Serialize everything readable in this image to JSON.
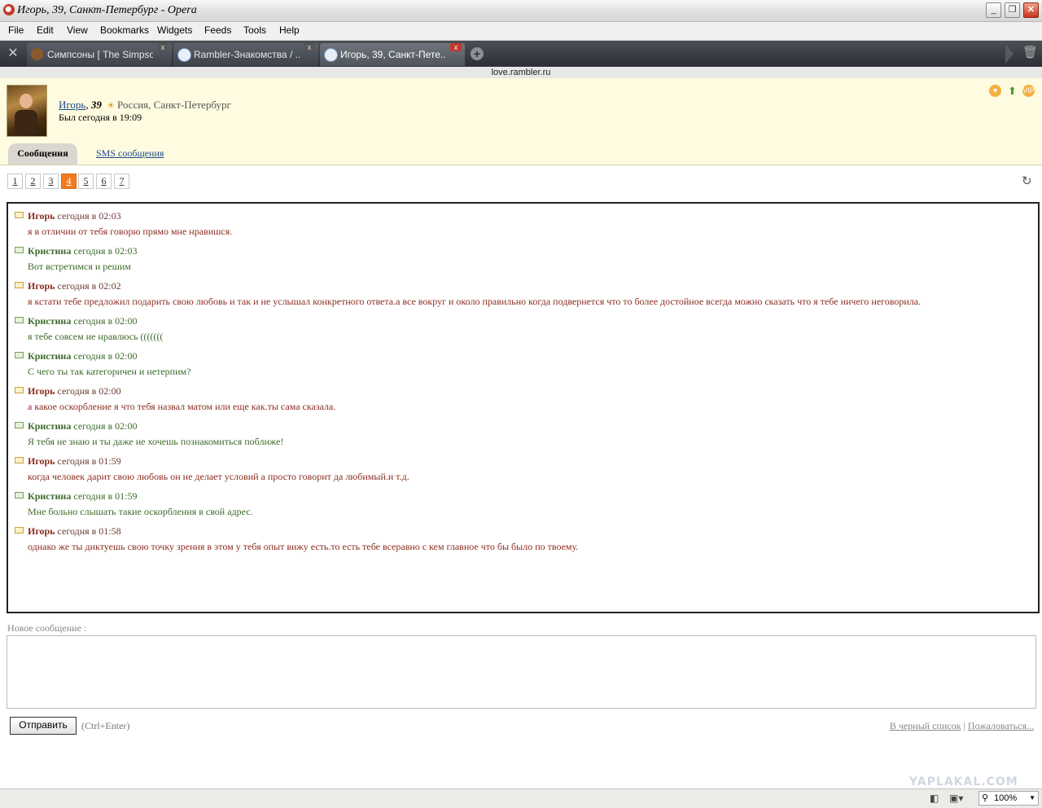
{
  "window": {
    "title": "Игорь, 39, Санкт-Петербург - Opera"
  },
  "menu": [
    "File",
    "Edit",
    "View",
    "Bookmarks",
    "Widgets",
    "Feeds",
    "Tools",
    "Help"
  ],
  "tabs": [
    {
      "label": "Симпсоны [ The Simpso...",
      "favicon": "simpsons-icon",
      "active": false
    },
    {
      "label": "Rambler-Знакомства / ...",
      "favicon": "rambler-icon",
      "active": false
    },
    {
      "label": "Игорь, 39, Санкт-Пете...",
      "favicon": "rambler-icon",
      "active": true
    }
  ],
  "address": "love.rambler.ru",
  "profile": {
    "name": "Игорь",
    "age": "39",
    "location": "Россия, Санкт-Петербург",
    "last_seen": "Был сегодня в 19:09"
  },
  "section_tabs": {
    "messages": "Сообщения",
    "sms": "SMS сообщения"
  },
  "pager": {
    "pages": [
      "1",
      "2",
      "3",
      "4",
      "5",
      "6",
      "7"
    ],
    "current": "4"
  },
  "messages": [
    {
      "author": "Игорь",
      "time": "сегодня в 02:03",
      "text": "я в отличии от тебя говорю прямо мне нравишся."
    },
    {
      "author": "Кристина",
      "time": "сегодня в 02:03",
      "text": "Вот встретимся и решим"
    },
    {
      "author": "Игорь",
      "time": "сегодня в 02:02",
      "text": "я кстати тебе предложил подарить свою любовь и так и не услышал конкретного ответа.а все вокруг и около правильно когда подвернется что то более достойное всегда можно сказать что я тебе ничего неговорила."
    },
    {
      "author": "Кристина",
      "time": "сегодня в 02:00",
      "text": "я тебе совсем не нравлюсь ((((((("
    },
    {
      "author": "Кристина",
      "time": "сегодня в 02:00",
      "text": "С чего ты так категоричен и нетерпим?"
    },
    {
      "author": "Игорь",
      "time": "сегодня в 02:00",
      "text": "а какое оскорбление я что тебя назвал матом или еще как.ты сама сказала."
    },
    {
      "author": "Кристина",
      "time": "сегодня в 02:00",
      "text": "Я тебя не знаю и ты даже не хочешь познакомиться поближе!"
    },
    {
      "author": "Игорь",
      "time": "сегодня в 01:59",
      "text": "когда человек дарит свою любовь он не делает условий а просто говорит да любимый.и т.д."
    },
    {
      "author": "Кристина",
      "time": "сегодня в 01:59",
      "text": "Мне больно слышать такие оскорбления в свой адрес."
    },
    {
      "author": "Игорь",
      "time": "сегодня в 01:58",
      "text": "однако же ты диктуешь свою точку зрения в этом у тебя опыт вижу есть.то есть тебе всеравно с кем главное что бы было по твоему."
    }
  ],
  "compose": {
    "label": "Новое сообщение :",
    "value": "",
    "send_label": "Отправить",
    "hint": "(Ctrl+Enter)",
    "blacklist": "В черный список",
    "separator": "|",
    "report": "Пожаловаться..."
  },
  "watermark": "YAPLAKAL.COM",
  "statusbar": {
    "zoom": "100%"
  },
  "colors": {
    "author_igor": "#8b2d20",
    "author_kristina": "#3d6a2a",
    "page_current": "#f07a1e",
    "profile_bg": "#fffbe0"
  }
}
